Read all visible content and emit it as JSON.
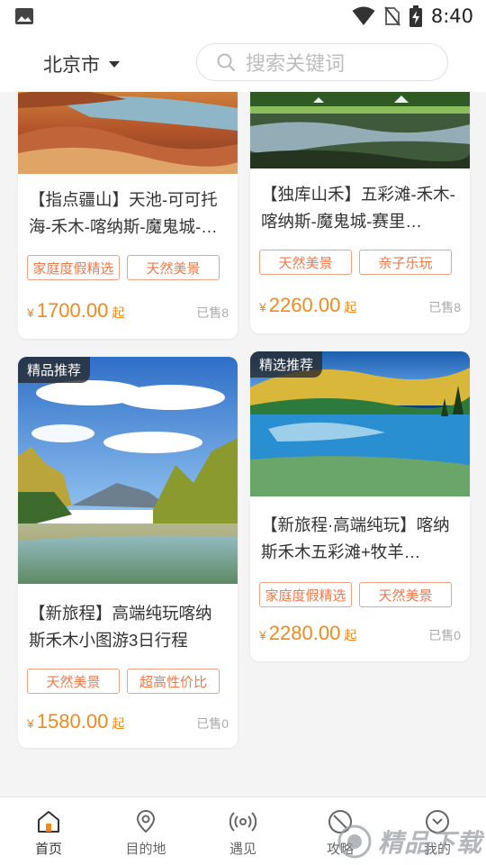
{
  "status_bar": {
    "time": "8:40"
  },
  "header": {
    "city": "北京市",
    "search_placeholder": "搜索关键词"
  },
  "cards": [
    {
      "title": "【指点疆山】天池-可可托海-禾木-喀纳斯-魔鬼城-…",
      "tags": [
        "家庭度假精选",
        "天然美景"
      ],
      "currency": "¥",
      "price": "1700.00",
      "price_suffix": "起",
      "sold": "已售8"
    },
    {
      "title": "【独库山禾】五彩滩-禾木-喀纳斯-魔鬼城-赛里…",
      "tags": [
        "天然美景",
        "亲子乐玩"
      ],
      "currency": "¥",
      "price": "2260.00",
      "price_suffix": "起",
      "sold": "已售8"
    },
    {
      "badge": "精品推荐",
      "title": "【新旅程】高端纯玩喀纳斯禾木小图游3日行程",
      "tags": [
        "天然美景",
        "超高性价比"
      ],
      "currency": "¥",
      "price": "1580.00",
      "price_suffix": "起",
      "sold": "已售0"
    },
    {
      "badge": "精选推荐",
      "title": "【新旅程·高端纯玩】喀纳斯禾木五彩滩+牧羊…",
      "tags": [
        "家庭度假精选",
        "天然美景"
      ],
      "currency": "¥",
      "price": "2280.00",
      "price_suffix": "起",
      "sold": "已售0"
    }
  ],
  "nav": [
    {
      "label": "首页",
      "icon": "home-icon",
      "active": true
    },
    {
      "label": "目的地",
      "icon": "location-pin-icon"
    },
    {
      "label": "遇见",
      "icon": "broadcast-icon"
    },
    {
      "label": "攻略",
      "icon": "guide-icon"
    },
    {
      "label": "我的",
      "icon": "profile-icon"
    }
  ],
  "watermark": {
    "text": "精品下载"
  },
  "colors": {
    "accent": "#f08a1c",
    "tag_border": "#f0a083",
    "tag_text": "#ee7a4b",
    "badge_bg": "#333333"
  }
}
